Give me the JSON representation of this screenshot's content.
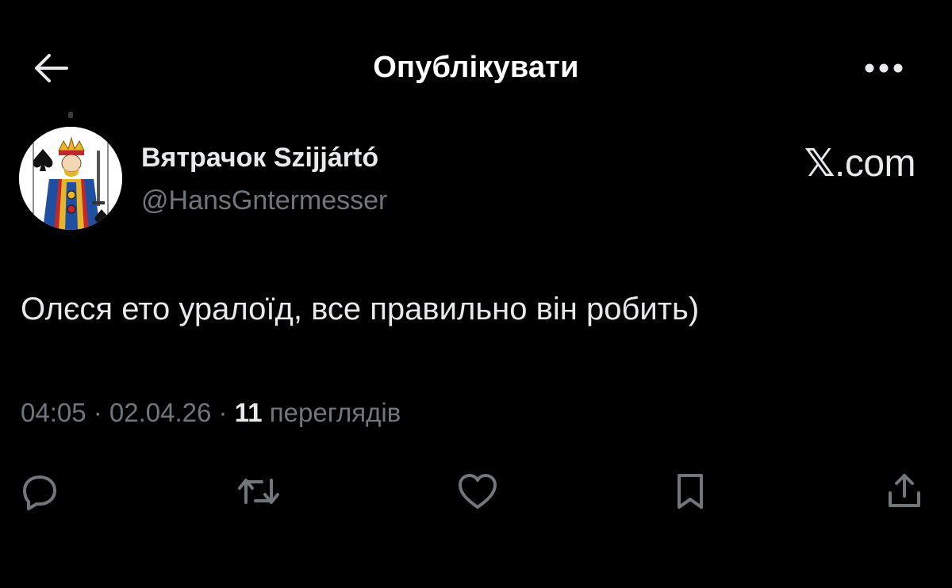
{
  "header": {
    "title": "Опублікувати",
    "back_icon": "arrow-left-icon",
    "more_icon": "more-horizontal-icon"
  },
  "post": {
    "author": {
      "display_name": "Вятрачок Szijjártó",
      "handle": "@HansGntermesser",
      "avatar": "king-of-spades-card-avatar"
    },
    "brand": {
      "mark": "𝕏",
      "suffix": ".com"
    },
    "text": "Олєся ето уралоїд, все правильно він робить)",
    "meta": {
      "time": "04:05",
      "separator1": " · ",
      "date": "02.04.26",
      "separator2": " · ",
      "views_count": "11",
      "views_label": " переглядів"
    }
  },
  "actions": [
    {
      "name": "reply",
      "icon": "reply-icon"
    },
    {
      "name": "repost",
      "icon": "repost-icon"
    },
    {
      "name": "like",
      "icon": "heart-icon"
    },
    {
      "name": "bookmark",
      "icon": "bookmark-icon"
    },
    {
      "name": "share",
      "icon": "share-icon"
    }
  ],
  "colors": {
    "background": "#000000",
    "primary_text": "#e7e9ea",
    "secondary_text": "#71767b"
  }
}
